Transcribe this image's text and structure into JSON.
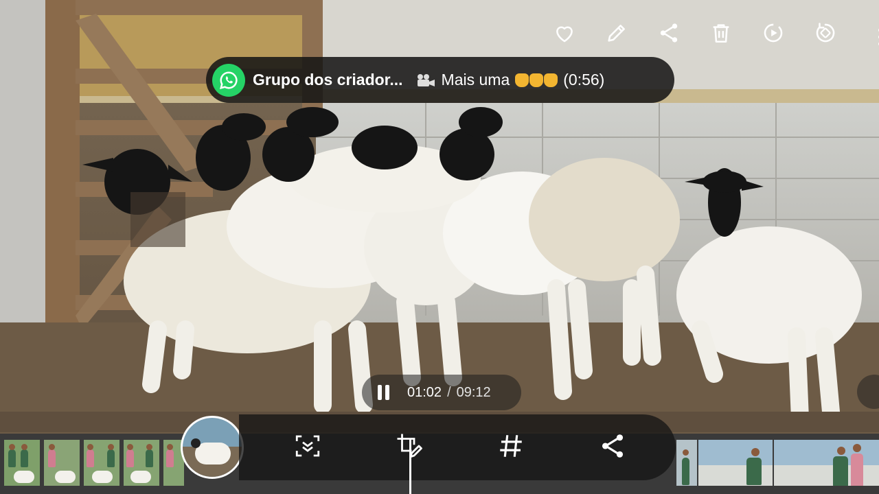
{
  "top_actions": [
    {
      "icon": "heart-icon"
    },
    {
      "icon": "pencil-icon"
    },
    {
      "icon": "share-icon"
    },
    {
      "icon": "trash-icon"
    },
    {
      "icon": "motion-photo-icon"
    },
    {
      "icon": "rotate-icon"
    }
  ],
  "notification": {
    "app_icon": "whatsapp-icon",
    "title": "Grupo dos criador...",
    "message_icon": "film-camera-icon",
    "message_text": "Mais uma",
    "message_emoji": "clapping-hands-icon",
    "duration": "(0:56)"
  },
  "player": {
    "state_icon": "pause-icon",
    "current_time": "01:02",
    "separator": "/",
    "total_time": "09:12"
  },
  "bottom_actions": [
    {
      "icon": "capture-frame-icon"
    },
    {
      "icon": "crop-edit-icon"
    },
    {
      "icon": "hashtag-icon"
    },
    {
      "icon": "share-icon"
    }
  ],
  "colors": {
    "whatsapp_green": "#25d366",
    "overlay_dark": "#161616"
  }
}
